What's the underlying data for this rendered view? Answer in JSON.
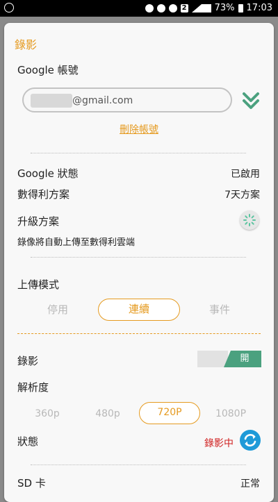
{
  "status_bar": {
    "battery": "73%",
    "time": "17:03",
    "sim_badge": "2"
  },
  "section": {
    "title": "錄影"
  },
  "account": {
    "label": "Google 帳號",
    "email_suffix": "@gmail.com",
    "delete_link": "刪除帳號"
  },
  "google_status": {
    "label": "Google 狀態",
    "value": "已啟用"
  },
  "plan": {
    "label": "數得利方案",
    "value": "7天方案"
  },
  "upgrade": {
    "label": "升級方案",
    "note": "錄像將自動上傳至數得利雲端"
  },
  "upload_mode": {
    "label": "上傳模式",
    "options": [
      "停用",
      "連續",
      "事件"
    ],
    "selected": "連續"
  },
  "recording": {
    "label": "錄影",
    "toggle_label": "開"
  },
  "resolution": {
    "label": "解析度",
    "options": [
      "360p",
      "480p",
      "720P",
      "1080P"
    ],
    "selected": "720P"
  },
  "status": {
    "label": "狀態",
    "value": "錄影中"
  },
  "sd_card": {
    "label": "SD 卡",
    "value": "正常"
  },
  "colors": {
    "accent": "#e59a1f",
    "toggle_on": "#4ba17f",
    "recording": "#d02020",
    "refresh": "#1e9ad8"
  }
}
